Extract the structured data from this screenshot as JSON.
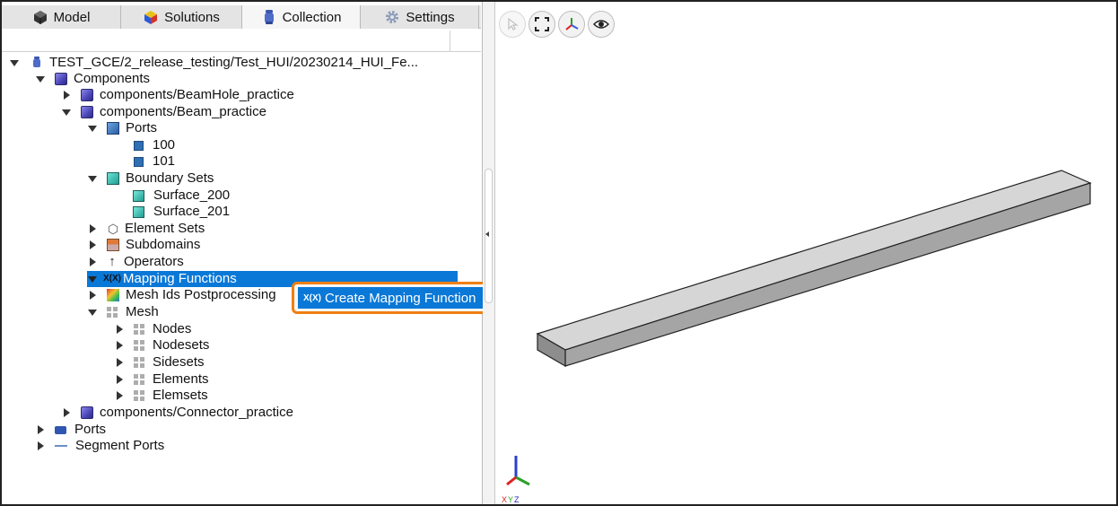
{
  "tabs": [
    {
      "label": "Model",
      "icon": "model-cube-icon"
    },
    {
      "label": "Solutions",
      "icon": "solutions-cube-icon"
    },
    {
      "label": "Collection",
      "icon": "collection-bottle-icon",
      "active": true
    },
    {
      "label": "Settings",
      "icon": "gear-icon"
    }
  ],
  "tree": {
    "root": "TEST_GCE/2_release_testing/Test_HUI/20230214_HUI_Fe...",
    "components": "Components",
    "beamhole": "components/BeamHole_practice",
    "beam": "components/Beam_practice",
    "ports": "Ports",
    "port100": "100",
    "port101": "101",
    "boundary_sets": "Boundary Sets",
    "surface200": "Surface_200",
    "surface201": "Surface_201",
    "element_sets": "Element Sets",
    "subdomains": "Subdomains",
    "operators": "Operators",
    "mapping_functions": "Mapping Functions",
    "mesh_ids_post": "Mesh Ids Postprocessing",
    "mesh": "Mesh",
    "nodes": "Nodes",
    "nodesets": "Nodesets",
    "sidesets": "Sidesets",
    "elements": "Elements",
    "elemsets": "Elemsets",
    "connector": "components/Connector_practice",
    "root_ports": "Ports",
    "segment_ports": "Segment Ports",
    "mapping_icon_text": "X(X)"
  },
  "context_menu": {
    "item": "Create Mapping Function",
    "icon_text": "X(X)"
  },
  "viewport": {
    "toolbar": [
      "select-pointer-icon",
      "fit-view-icon",
      "axes-orient-icon",
      "visibility-eye-icon"
    ],
    "axes_label": {
      "x": "X",
      "y": "Y",
      "z": "Z"
    }
  },
  "colors": {
    "selection": "#0a78d7",
    "highlight_border": "#f07f12"
  }
}
